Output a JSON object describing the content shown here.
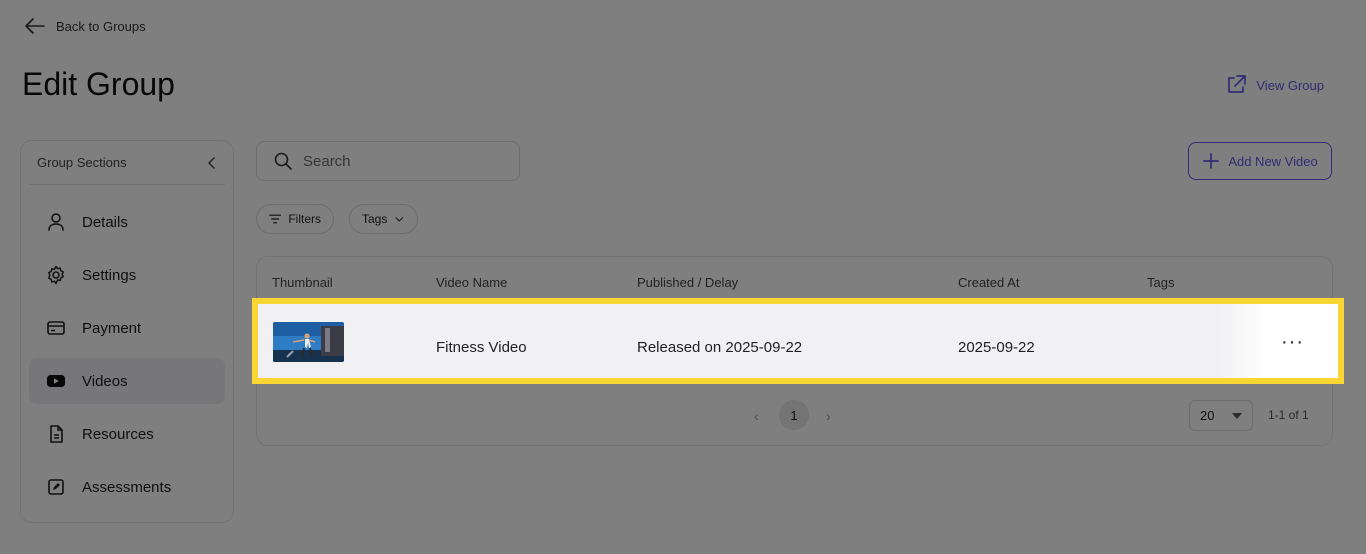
{
  "header": {
    "back_label": "Back to Groups",
    "title": "Edit Group",
    "view_group_label": "View Group",
    "accent_color": "#6457e8"
  },
  "sidebar": {
    "title": "Group Sections",
    "items": [
      {
        "label": "Details",
        "icon": "user-icon"
      },
      {
        "label": "Settings",
        "icon": "gear-icon"
      },
      {
        "label": "Payment",
        "icon": "card-icon"
      },
      {
        "label": "Videos",
        "icon": "youtube-icon",
        "active": true
      },
      {
        "label": "Resources",
        "icon": "document-icon"
      },
      {
        "label": "Assessments",
        "icon": "edit-square-icon"
      }
    ]
  },
  "toolbar": {
    "search_placeholder": "Search",
    "add_video_label": "Add New Video",
    "filters_label": "Filters",
    "tags_label": "Tags"
  },
  "table": {
    "columns": [
      "Thumbnail",
      "Video Name",
      "Published / Delay",
      "Created At",
      "Tags"
    ],
    "rows": [
      {
        "video_name": "Fitness Video",
        "published": "Released on 2025-09-22",
        "created_at": "2025-09-22",
        "tags": "",
        "more": "···"
      }
    ]
  },
  "pagination": {
    "current_page": "1",
    "page_size": "20",
    "range": "1-1 of 1"
  },
  "highlight_color": "#fbd534"
}
